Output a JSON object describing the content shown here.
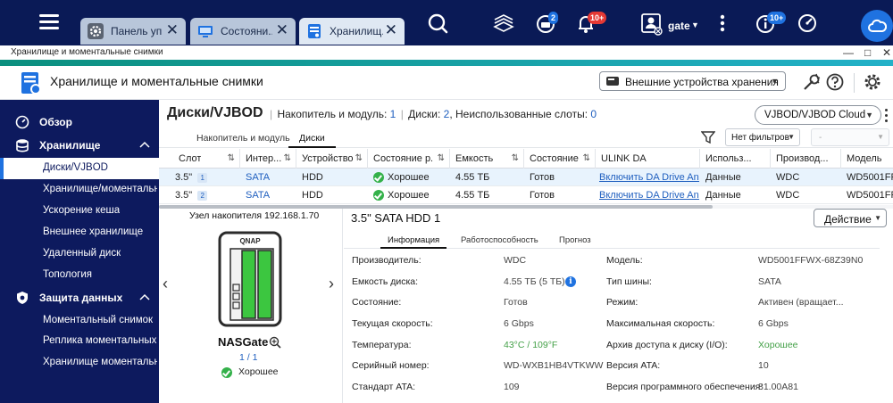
{
  "taskbar": {
    "tabs": [
      {
        "label": "Панель уп...",
        "icon": "gear-icon"
      },
      {
        "label": "Состояни...",
        "icon": "monitor-icon"
      },
      {
        "label": "Хранилищ...",
        "icon": "storage-icon"
      }
    ],
    "badges": {
      "tasks": "2",
      "notifications": "10+",
      "updates": "10+"
    },
    "user": "gate"
  },
  "window": {
    "title": "Хранилище и моментальные снимки"
  },
  "app_header": {
    "title": "Хранилище и моментальные снимки",
    "external_storage_label": "Внешние устройства хранения"
  },
  "sidebar": {
    "items": [
      {
        "label": "Обзор"
      },
      {
        "label": "Хранилище"
      },
      {
        "label": "Диски/VJBOD"
      },
      {
        "label": "Хранилище/моментальн..."
      },
      {
        "label": "Ускорение кеша"
      },
      {
        "label": "Внешнее хранилище"
      },
      {
        "label": "Удаленный диск"
      },
      {
        "label": "Топология"
      },
      {
        "label": "Защита данных"
      },
      {
        "label": "Моментальный снимок"
      },
      {
        "label": "Реплика моментальных ..."
      },
      {
        "label": "Хранилище моментальн..."
      }
    ]
  },
  "main": {
    "title": "Диски/VJBOD",
    "summary": {
      "p1": "Накопитель и модуль:",
      "v1": "1",
      "p2": "Диски:",
      "v2": "2",
      "p3": ", Неиспользованные слоты:",
      "v3": "0"
    },
    "vjbod_button": "VJBOD/VJBOD Cloud",
    "subtabs": [
      "Накопитель и модуль",
      "Диски"
    ],
    "filter": {
      "selected": "Нет фильтров",
      "second": "-"
    }
  },
  "table": {
    "columns": [
      "Слот",
      "Интер...",
      "Устройство",
      "Состояние р...",
      "Емкость",
      "Состояние",
      "ULINK DA",
      "Использ...",
      "Производ...",
      "Модель"
    ],
    "rows": [
      {
        "slot": "3.5\"",
        "slot_num": "1",
        "interface": "SATA",
        "device": "HDD",
        "health": "Хорошее",
        "capacity": "4.55 ТБ",
        "status": "Готов",
        "ulink": "Включить DA Drive An...",
        "usage": "Данные",
        "vendor": "WDC",
        "model": "WD5001FFW"
      },
      {
        "slot": "3.5\"",
        "slot_num": "2",
        "interface": "SATA",
        "device": "HDD",
        "health": "Хорошее",
        "capacity": "4.55 ТБ",
        "status": "Готов",
        "ulink": "Включить DA Drive An...",
        "usage": "Данные",
        "vendor": "WDC",
        "model": "WD5001FFW"
      }
    ]
  },
  "node": {
    "label": "Узел накопителя",
    "ip": "192.168.1.70",
    "name": "NASGate",
    "pager": "1 / 1",
    "status": "Хорошее",
    "brand": "QNAP"
  },
  "disk": {
    "title": "3.5\" SATA HDD 1",
    "action_label": "Действие",
    "tabs": [
      "Информация",
      "Работоспособность",
      "Прогноз"
    ],
    "left": [
      {
        "label": "Производитель:",
        "value": "WDC"
      },
      {
        "label": "Емкость диска:",
        "value": "4.55 ТБ (5 ТБ)"
      },
      {
        "label": "Состояние:",
        "value": "Готов"
      },
      {
        "label": "Текущая скорость:",
        "value": "6 Gbps"
      },
      {
        "label": "Температура:",
        "value": "43°C / 109°F"
      },
      {
        "label": "Серийный номер:",
        "value": "WD-WXB1HB4VTKWW"
      },
      {
        "label": "Стандарт ATA:",
        "value": "109"
      }
    ],
    "right": [
      {
        "label": "Модель:",
        "value": "WD5001FFWX-68Z39N0"
      },
      {
        "label": "Тип шины:",
        "value": "SATA"
      },
      {
        "label": "Режим:",
        "value": "Активен (вращает..."
      },
      {
        "label": "Максимальная скорость:",
        "value": "6 Gbps"
      },
      {
        "label": "Архив доступа к диску (I/O):",
        "value": "Хорошее"
      },
      {
        "label": "Версия ATA:",
        "value": "10"
      },
      {
        "label": "Версия программного обеспечения:",
        "value": "81.00A81"
      }
    ]
  },
  "colors": {
    "taskbar": "#0a1a56",
    "sidebar": "#0d1a5e",
    "accent": "#1f72e0",
    "good": "#34b14a",
    "link": "#1f5fbf"
  }
}
